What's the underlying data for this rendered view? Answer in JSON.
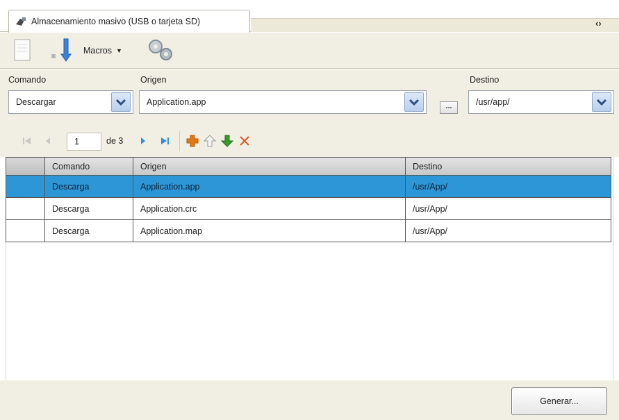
{
  "tab": {
    "title": "Almacenamiento masivo (USB o tarjeta SD)",
    "nav_arrows": "‹›"
  },
  "toolbar": {
    "macros_label": "Macros"
  },
  "form": {
    "command_label": "Comando",
    "command_value": "Descargar",
    "source_label": "Origen",
    "source_value": "Application.app",
    "browse_label": "...",
    "dest_label": "Destino",
    "dest_value": "/usr/app/"
  },
  "pager": {
    "current_page": "1",
    "of_label": "de 3"
  },
  "grid": {
    "columns": [
      "Comando",
      "Origen",
      "Destino"
    ],
    "rows": [
      {
        "command": "Descarga",
        "source": "Application.app",
        "dest": "/usr/App/",
        "selected": true
      },
      {
        "command": "Descarga",
        "source": "Application.crc",
        "dest": "/usr/App/",
        "selected": false
      },
      {
        "command": "Descarga",
        "source": "Application.map",
        "dest": "/usr/App/",
        "selected": false
      }
    ]
  },
  "footer": {
    "generate_label": "Generar..."
  },
  "colors": {
    "panel_bg": "#f1efe4",
    "selection": "#2d96d6",
    "add_icon": "#e07a14",
    "down_icon": "#3a9a2a",
    "delete_icon": "#e05a2a",
    "nav_icon": "#2f8ee0"
  }
}
